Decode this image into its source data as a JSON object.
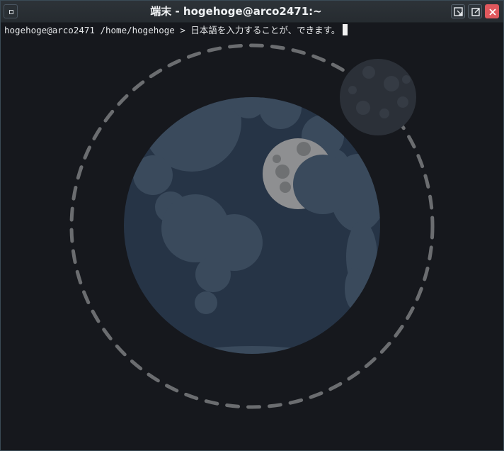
{
  "window": {
    "title": "端末 - hogehoge@arco2471:~"
  },
  "titlebar_buttons": [
    {
      "name": "minimize-button",
      "icon": "minimize-icon"
    },
    {
      "name": "maximize-button",
      "icon": "maximize-icon"
    },
    {
      "name": "close-button",
      "icon": "close-icon"
    }
  ],
  "terminal": {
    "user_host": "hogehoge@arco2471",
    "cwd": "/home/hogehoge",
    "prompt_symbol": ">",
    "input_text": "日本語を入力することが、できます。"
  },
  "colors": {
    "background": "#16181d",
    "earth_ocean": "#263446",
    "earth_land": "#3a4a5c",
    "moon": "#8e8f91",
    "orbit": "#6b6d70",
    "close": "#e0585d"
  }
}
